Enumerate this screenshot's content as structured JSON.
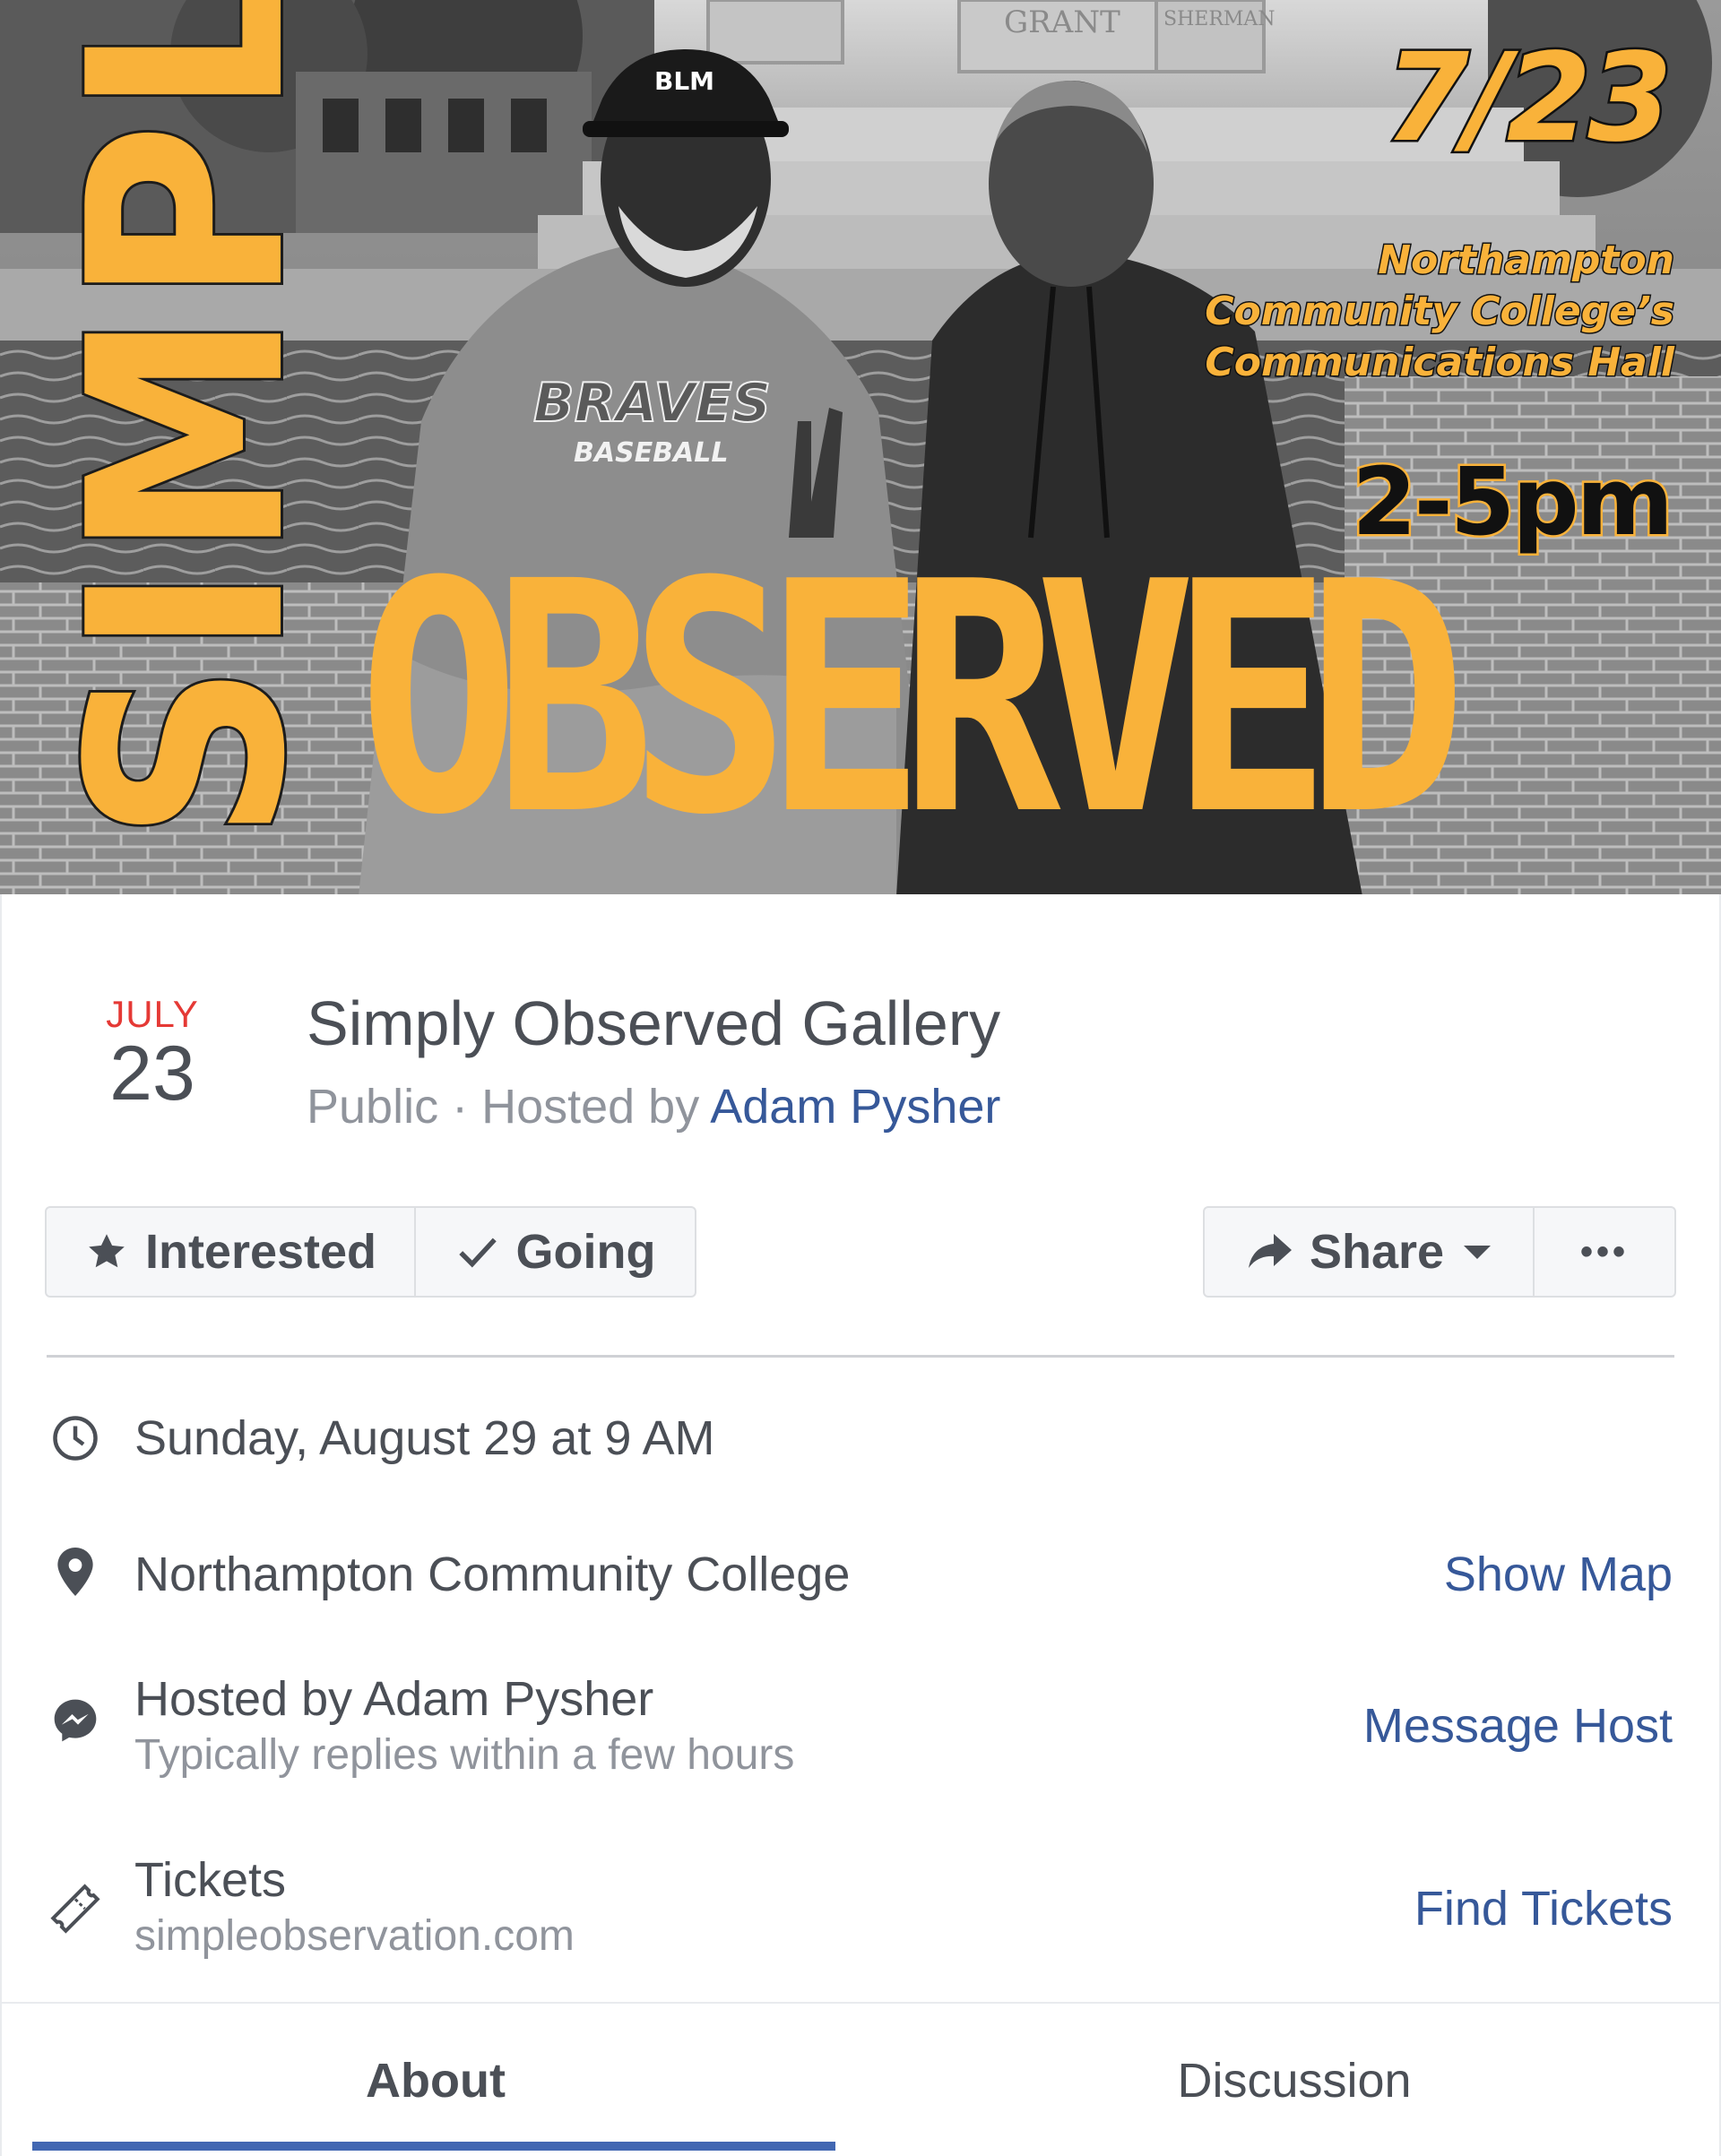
{
  "cover": {
    "vertical_title": "SIMPLY",
    "main_title": "OBSERVED",
    "date": "7/23",
    "venue_lines": [
      "Northampton",
      "Community College’s",
      "Communications Hall"
    ],
    "time": "2-5pm",
    "monument_labels": [
      "GRANT",
      "SHERMAN"
    ],
    "cap_text": "BLM",
    "shirt_text": "BRAVES",
    "shirt_subtext": "BASEBALL",
    "accent_color": "#f9b23a"
  },
  "event": {
    "month": "JULY",
    "day": "23",
    "title": "Simply Observed Gallery",
    "privacy": "Public",
    "meta_separator": " · ",
    "hosted_by_prefix": "Hosted by ",
    "host_name": "Adam Pysher"
  },
  "actions": {
    "interested_label": "Interested",
    "going_label": "Going",
    "share_label": "Share",
    "more_label": "•••"
  },
  "details": {
    "datetime": {
      "icon": "clock-icon",
      "text": "Sunday, August 29 at 9 AM"
    },
    "location": {
      "icon": "location-pin-icon",
      "text": "Northampton Community College",
      "link": "Show Map"
    },
    "host": {
      "icon": "messenger-icon",
      "text": "Hosted by Adam Pysher",
      "subtext": "Typically replies within a few hours",
      "link": "Message Host"
    },
    "tickets": {
      "icon": "ticket-icon",
      "text": "Tickets",
      "subtext": "simpleobservation.com",
      "link": "Find Tickets"
    }
  },
  "tabs": [
    {
      "label": "About",
      "active": true
    },
    {
      "label": "Discussion",
      "active": false
    }
  ],
  "colors": {
    "link": "#365899",
    "month": "#e53935",
    "tab_active": "#4267b2"
  }
}
